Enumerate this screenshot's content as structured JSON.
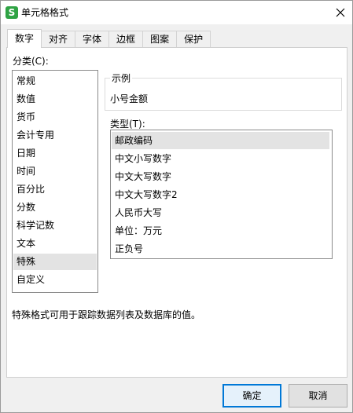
{
  "window": {
    "title": "单元格格式",
    "app_icon": "S",
    "close_icon": "close-icon"
  },
  "tabs": [
    {
      "label": "数字",
      "active": true
    },
    {
      "label": "对齐"
    },
    {
      "label": "字体"
    },
    {
      "label": "边框"
    },
    {
      "label": "图案"
    },
    {
      "label": "保护"
    }
  ],
  "category": {
    "label": "分类(C):",
    "items": [
      "常规",
      "数值",
      "货币",
      "会计专用",
      "日期",
      "时间",
      "百分比",
      "分数",
      "科学记数",
      "文本",
      "特殊",
      "自定义"
    ],
    "selected": "特殊"
  },
  "example": {
    "legend": "示例",
    "value": "小号金额"
  },
  "type": {
    "label": "类型(T):",
    "items": [
      "邮政编码",
      "中文小写数字",
      "中文大写数字",
      "中文大写数字2",
      "人民币大写",
      "单位：万元",
      "正负号"
    ],
    "selected": "邮政编码"
  },
  "description": "特殊格式可用于跟踪数据列表及数据库的值。",
  "buttons": {
    "ok": "确定",
    "cancel": "取消"
  }
}
